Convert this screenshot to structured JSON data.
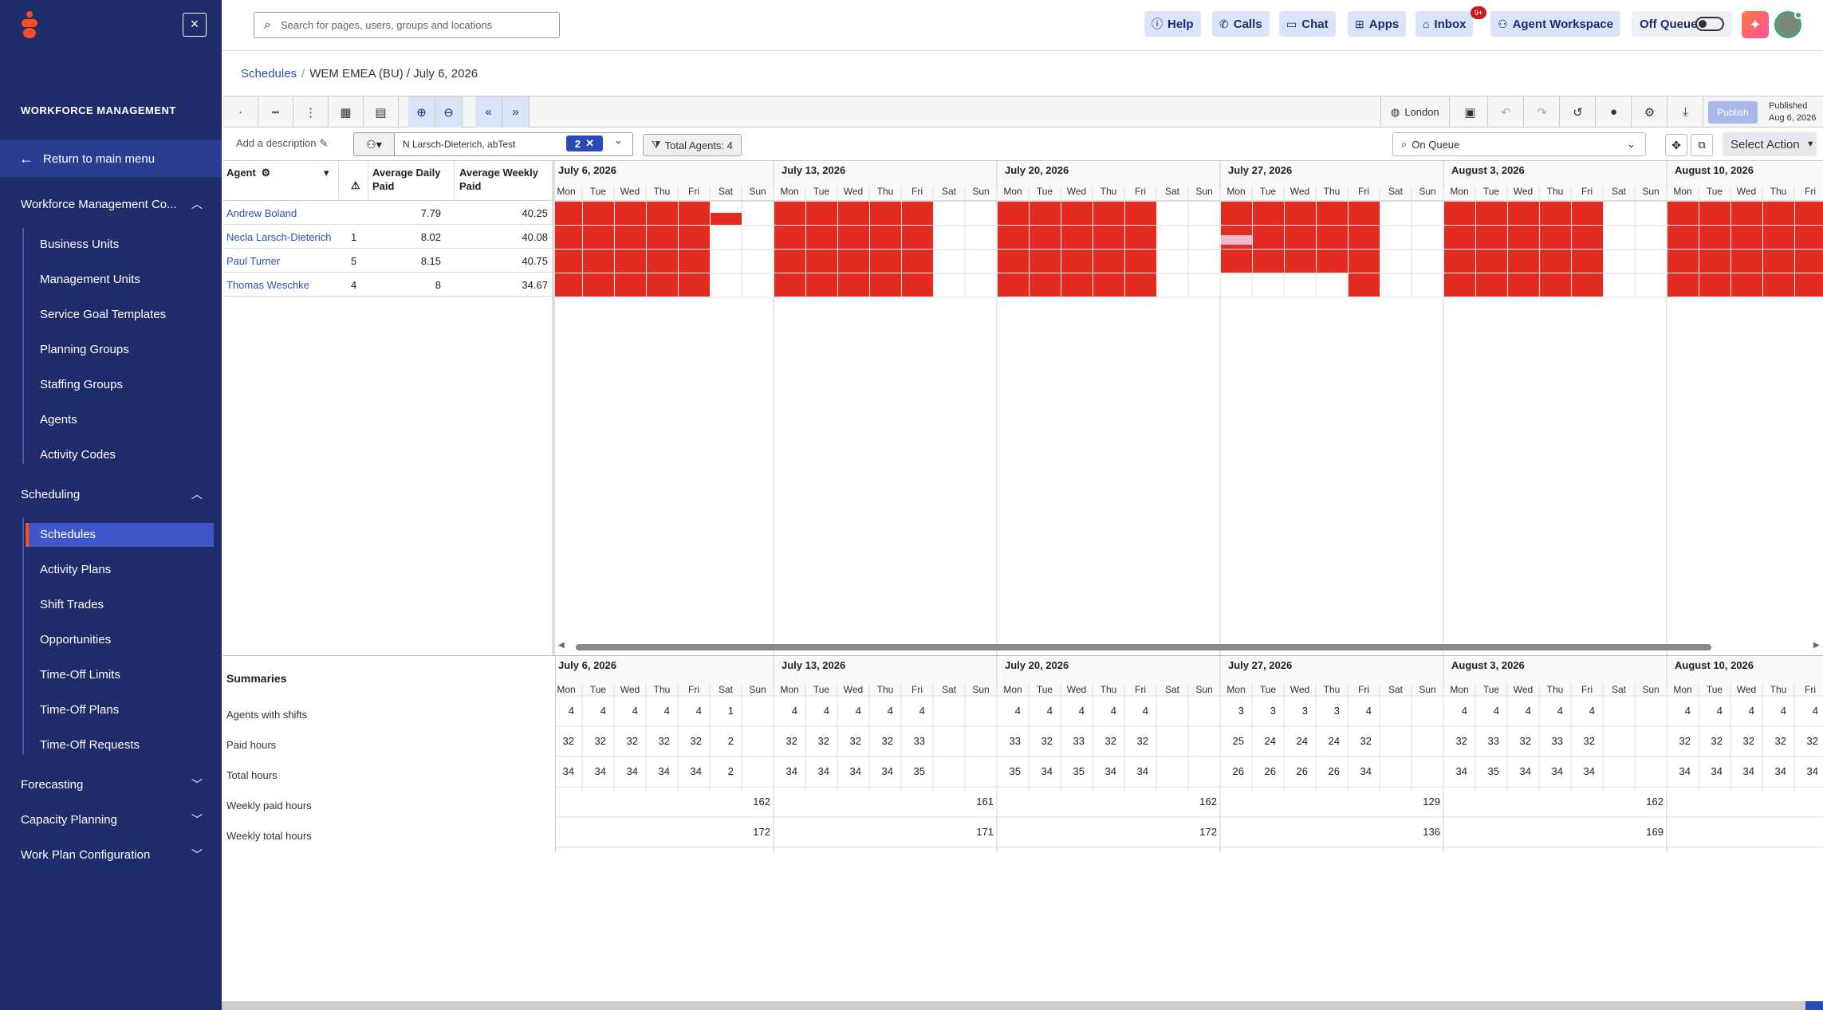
{
  "sidebar": {
    "title": "WORKFORCE MANAGEMENT",
    "return_label": "Return to main menu",
    "groups": [
      {
        "label": "Workforce Management Co...",
        "expanded": true
      },
      {
        "label": "Scheduling",
        "expanded": true
      },
      {
        "label": "Forecasting",
        "expanded": false
      },
      {
        "label": "Capacity Planning",
        "expanded": false
      },
      {
        "label": "Work Plan Configuration",
        "expanded": false
      }
    ],
    "wfm_items": [
      "Business Units",
      "Management Units",
      "Service Goal Templates",
      "Planning Groups",
      "Staffing Groups",
      "Agents",
      "Activity Codes"
    ],
    "scheduling_items": [
      "Schedules",
      "Activity Plans",
      "Shift Trades",
      "Opportunities",
      "Time-Off Limits",
      "Time-Off Plans",
      "Time-Off Requests"
    ],
    "active_item": "Schedules"
  },
  "topbar": {
    "search_placeholder": "Search for pages, users, groups and locations",
    "buttons": [
      "Help",
      "Calls",
      "Chat",
      "Apps",
      "Inbox",
      "Agent Workspace"
    ],
    "inbox_badge": "9+",
    "off_queue": "Off Queue"
  },
  "breadcrumb": {
    "root": "Schedules",
    "current": "WEM EMEA (BU) / July 6, 2026"
  },
  "toolbar": {
    "timezone": "London",
    "publish": "Publish",
    "published_label": "Published",
    "published_date": "Aug 6, 2026",
    "add_description": "Add a description",
    "agent_filter": "N Larsch-Dieterich, abTest",
    "agent_filter_count": "2",
    "total_agents": "Total Agents: 4",
    "queue": "On Queue",
    "select_action": "Select Action"
  },
  "agent_table": {
    "headers": {
      "agent": "Agent",
      "avg_daily": "Average Daily Paid",
      "avg_weekly": "Average Weekly Paid"
    },
    "rows": [
      {
        "name": "Andrew Boland",
        "warn": "",
        "daily": "7.79",
        "weekly": "40.25"
      },
      {
        "name": "Necla Larsch-Dieterich",
        "warn": "1",
        "daily": "8.02",
        "weekly": "40.08"
      },
      {
        "name": "Paul Turner",
        "warn": "5",
        "daily": "8.15",
        "weekly": "40.75"
      },
      {
        "name": "Thomas Weschke",
        "warn": "4",
        "daily": "8",
        "weekly": "34.67"
      }
    ]
  },
  "schedule": {
    "weeks": [
      "July 6, 2026",
      "July 13, 2026",
      "July 20, 2026",
      "July 27, 2026",
      "August 3, 2026",
      "August 10, 2026"
    ],
    "day_labels": [
      "Mon",
      "Tue",
      "Wed",
      "Thu",
      "Fri",
      "Sat",
      "Sun"
    ],
    "colors": {
      "shift": "#e32b22",
      "timeoff": "#f4b8d0",
      "grid": "#dddddd"
    },
    "shifts": [
      "WWWWWhxWWWWWxxWWWWWxxWWWWWxxWWWWWxxWWWWW",
      "WWWWWxxWWWWWxxWWWWWxxtWWWWxxWWWWWxxWWWWW",
      "WWWWWxxWWWWWxxWWWWWxxWWWWWxxWWWWWxxWWWWW",
      "WWWWWxxWWWWWxxWWWWWxxxxxxWxxWWWWWxxWWWWW"
    ]
  },
  "summaries": {
    "title": "Summaries",
    "labels": [
      "Agents with shifts",
      "Paid hours",
      "Total hours",
      "Weekly paid hours",
      "Weekly total hours"
    ],
    "agents_with_shifts": [
      "4",
      "4",
      "4",
      "4",
      "4",
      "1",
      "",
      "4",
      "4",
      "4",
      "4",
      "4",
      "",
      "",
      "4",
      "4",
      "4",
      "4",
      "4",
      "",
      "",
      "3",
      "3",
      "3",
      "3",
      "4",
      "",
      "",
      "4",
      "4",
      "4",
      "4",
      "4",
      "",
      "",
      "4",
      "4",
      "4",
      "4",
      "4"
    ],
    "paid_hours": [
      "32",
      "32",
      "32",
      "32",
      "32",
      "2",
      "",
      "32",
      "32",
      "32",
      "32",
      "33",
      "",
      "",
      "33",
      "32",
      "33",
      "32",
      "32",
      "",
      "",
      "25",
      "24",
      "24",
      "24",
      "32",
      "",
      "",
      "32",
      "33",
      "32",
      "33",
      "32",
      "",
      "",
      "32",
      "32",
      "32",
      "32",
      "32"
    ],
    "total_hours": [
      "34",
      "34",
      "34",
      "34",
      "34",
      "2",
      "",
      "34",
      "34",
      "34",
      "34",
      "35",
      "",
      "",
      "35",
      "34",
      "35",
      "34",
      "34",
      "",
      "",
      "26",
      "26",
      "26",
      "26",
      "34",
      "",
      "",
      "34",
      "35",
      "34",
      "34",
      "34",
      "",
      "",
      "34",
      "34",
      "34",
      "34",
      "34"
    ],
    "weekly_paid": [
      "162",
      "161",
      "162",
      "129",
      "162"
    ],
    "weekly_total": [
      "172",
      "171",
      "172",
      "136",
      "169"
    ]
  }
}
